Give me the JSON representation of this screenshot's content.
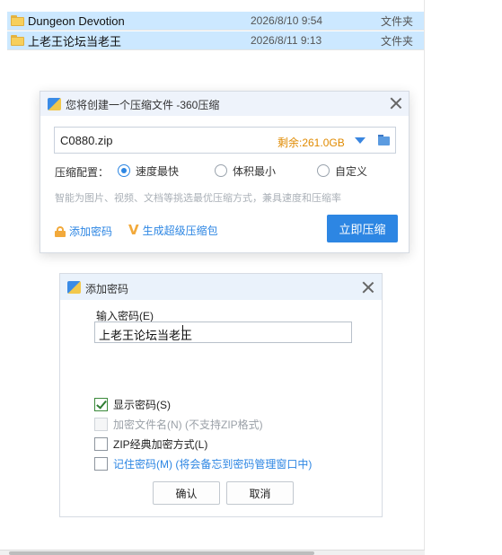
{
  "explorer": {
    "files": [
      {
        "name": "Dungeon Devotion",
        "date": "2026/8/10 9:54",
        "type": "文件夹",
        "icon": "folder-icon"
      },
      {
        "name": "上老王论坛当老王",
        "date": "2026/8/11 9:13",
        "type": "文件夹",
        "icon": "folder-icon"
      }
    ]
  },
  "compress_dialog": {
    "title": "您将创建一个压缩文件 -360压缩",
    "filename": "C0880.zip",
    "free_space": "剩余:261.0GB",
    "config_label": "压缩配置：",
    "options": [
      {
        "label": "速度最快",
        "selected": true
      },
      {
        "label": "体积最小",
        "selected": false
      },
      {
        "label": "自定义",
        "selected": false
      }
    ],
    "hint": "智能为图片、视频、文档等挑选最优压缩方式，兼具速度和压缩率",
    "add_password_link": "添加密码",
    "super_pack_link": "生成超级压缩包",
    "compress_button": "立即压缩"
  },
  "password_dialog": {
    "title": "添加密码",
    "input_label": "输入密码(E)",
    "password_value": "上老王论坛当老王",
    "checkboxes": [
      {
        "label": "显示密码(S)",
        "checked": true,
        "enabled": true
      },
      {
        "label": "加密文件名(N) (不支持ZIP格式)",
        "checked": false,
        "enabled": false
      },
      {
        "label": "ZIP经典加密方式(L)",
        "checked": false,
        "enabled": true
      },
      {
        "label": "记住密码(M) (将会备忘到密码管理窗口中)",
        "checked": false,
        "enabled": true
      }
    ],
    "ok_button": "确认",
    "cancel_button": "取消"
  },
  "colors": {
    "accent": "#2d86e3",
    "warning": "#e08a00",
    "selection": "#cce8ff"
  }
}
